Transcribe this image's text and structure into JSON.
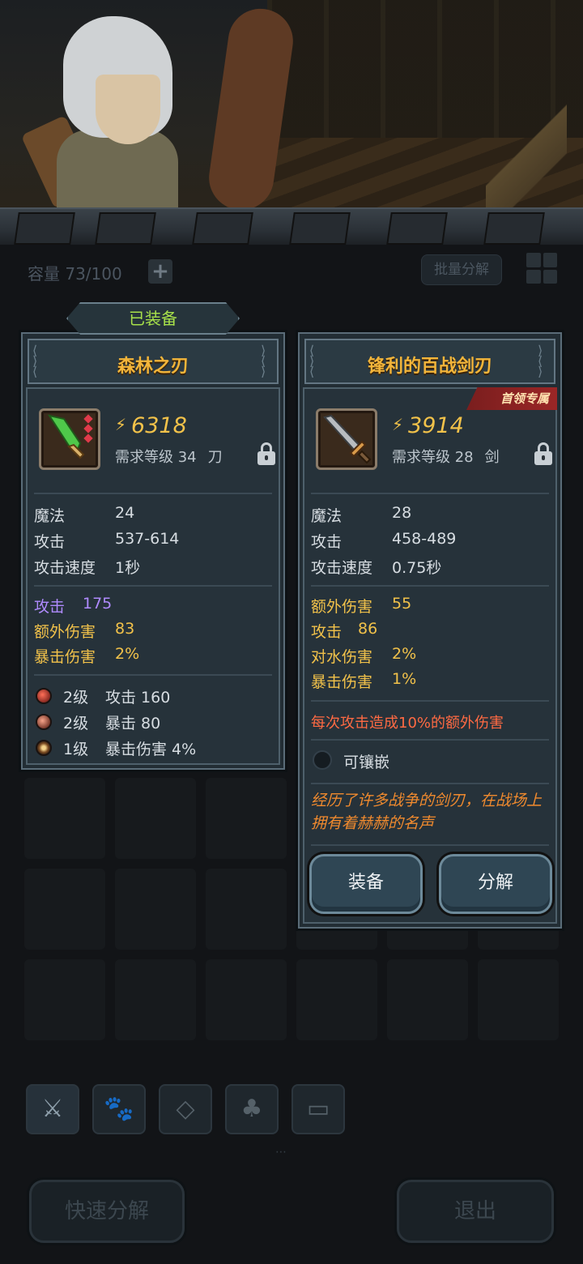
{
  "inventory": {
    "capacity_label": "容量 73/100",
    "add_symbol": "+",
    "bulk_decompose": "批量分解"
  },
  "equipped_tab": "已装备",
  "equipped_item": {
    "name": "森林之刃",
    "power": "6318",
    "requirement": "需求等级 34",
    "weapon_type": "刀",
    "icon": "green-blade-icon",
    "base_stats": [
      {
        "label": "魔法",
        "value": "24"
      },
      {
        "label": "攻击",
        "value": "537-614"
      },
      {
        "label": "攻击速度",
        "value": "1秒"
      }
    ],
    "bonus_stats": [
      {
        "label": "攻击",
        "value": "175"
      },
      {
        "label": "额外伤害",
        "value": "83"
      },
      {
        "label": "暴击伤害",
        "value": "2%"
      }
    ],
    "gems": [
      {
        "level": "2级",
        "effect": "攻击 160"
      },
      {
        "level": "2级",
        "effect": "暴击 80"
      },
      {
        "level": "1级",
        "effect": "暴击伤害 4%"
      }
    ]
  },
  "new_item": {
    "name": "锋利的百战剑刃",
    "ribbon": "首领专属",
    "power": "3914",
    "requirement": "需求等级 28",
    "weapon_type": "剑",
    "icon": "steel-sword-icon",
    "base_stats": [
      {
        "label": "魔法",
        "value": "28"
      },
      {
        "label": "攻击",
        "value": "458-489"
      },
      {
        "label": "攻击速度",
        "value": "0.75秒"
      }
    ],
    "bonus_stats": [
      {
        "label": "额外伤害",
        "value": "55"
      },
      {
        "label": "攻击",
        "value": "86"
      },
      {
        "label": "对水伤害",
        "value": "2%"
      },
      {
        "label": "暴击伤害",
        "value": "1%"
      }
    ],
    "passive": "每次攻击造成10%的额外伤害",
    "socket_label": "可镶嵌",
    "lore": "经历了许多战争的剑刃，在战场上拥有着赫赫的名声",
    "equip_button": "装备",
    "decompose_button": "分解"
  },
  "bottom": {
    "quick_decompose": "快速分解",
    "exit": "退出",
    "page_indicator": "⋯"
  },
  "colors": {
    "title_gold": "#f3b53a",
    "equipped_green": "#a7e04a",
    "bonus_purple": "#b08bff",
    "bonus_gold": "#f2c24a",
    "passive_red": "#ff6a43",
    "lore_orange": "#f08a2e"
  }
}
